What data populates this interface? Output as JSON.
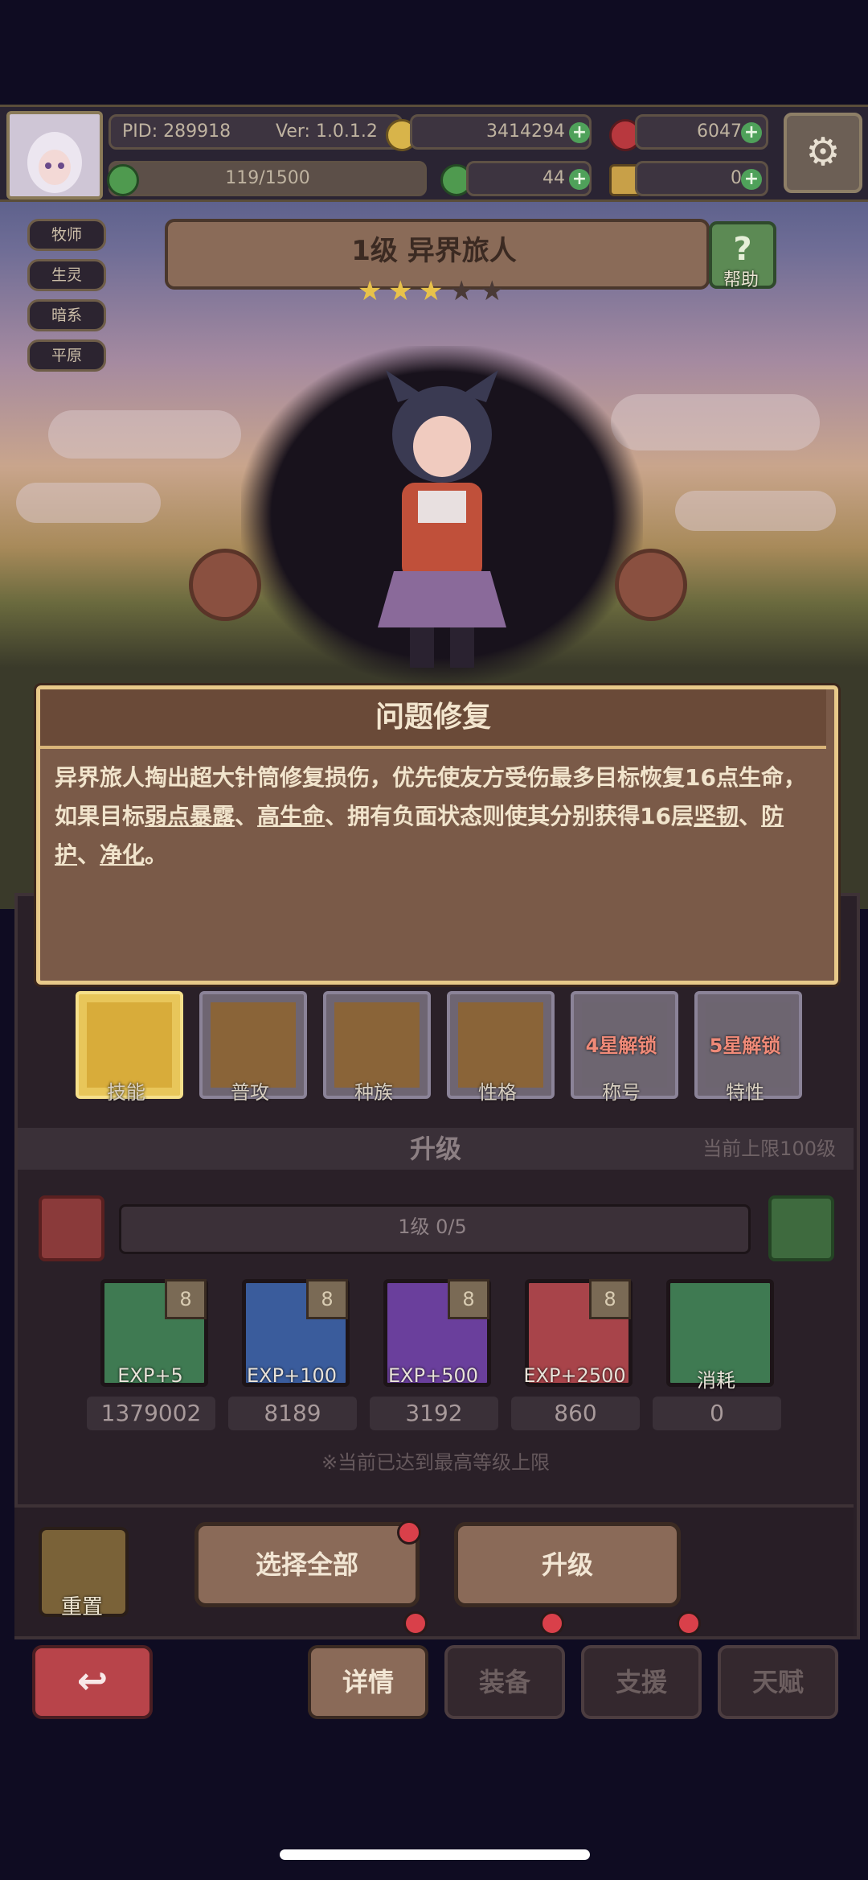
{
  "top": {
    "pid": "PID: 289918",
    "version": "Ver: 1.0.1.2",
    "gold": "3414294",
    "gems": "6047",
    "stamina": "119/1500",
    "clover": "44",
    "keys": "0"
  },
  "tags": [
    "牧师",
    "生灵",
    "暗系",
    "平原"
  ],
  "hero": {
    "name": "1级  异界旅人",
    "stars_total": 5,
    "stars_filled": 3,
    "help_label": "帮助"
  },
  "popup": {
    "title": "问题修复",
    "text_parts": [
      {
        "t": "异界旅人掏出超大针筒修复损伤，优先使友方受伤最多目标恢复16点生命，如果目标",
        "u": false
      },
      {
        "t": "弱点暴露",
        "u": true
      },
      {
        "t": "、",
        "u": false
      },
      {
        "t": "高生命",
        "u": true
      },
      {
        "t": "、拥有负面状态则使其分别获得16层",
        "u": false
      },
      {
        "t": "坚韧",
        "u": true
      },
      {
        "t": "、",
        "u": false
      },
      {
        "t": "防护",
        "u": true
      },
      {
        "t": "、",
        "u": false
      },
      {
        "t": "净化",
        "u": true
      },
      {
        "t": "。",
        "u": false
      }
    ]
  },
  "tabs": [
    {
      "label": "技能",
      "active": true,
      "lock": ""
    },
    {
      "label": "普攻",
      "active": false,
      "lock": ""
    },
    {
      "label": "种族",
      "active": false,
      "lock": ""
    },
    {
      "label": "性格",
      "active": false,
      "lock": ""
    },
    {
      "label": "称号",
      "active": false,
      "lock": "4星解锁"
    },
    {
      "label": "特性",
      "active": false,
      "lock": "5星解锁"
    }
  ],
  "upgrade": {
    "title": "升级",
    "limit": "当前上限100级",
    "level_text": "1级  0/5",
    "items": [
      {
        "label": "EXP+5",
        "count": "1379002",
        "badge": "8",
        "color": "#3f7a52"
      },
      {
        "label": "EXP+100",
        "count": "8189",
        "badge": "8",
        "color": "#3a5c9c"
      },
      {
        "label": "EXP+500",
        "count": "3192",
        "badge": "8",
        "color": "#6a3f9c"
      },
      {
        "label": "EXP+2500",
        "count": "860",
        "badge": "8",
        "color": "#a8444a"
      },
      {
        "label": "消耗",
        "count": "0",
        "badge": "",
        "color": "#3f7a52"
      }
    ],
    "max_note": "※当前已达到最高等级上限"
  },
  "actions": {
    "reset": "重置",
    "select_all": "选择全部",
    "upgrade": "升级"
  },
  "nav": {
    "details": "详情",
    "equip": "装备",
    "support": "支援",
    "talent": "天赋"
  },
  "colors": {
    "accent_gold": "#e8c98a",
    "popup_bg": "#7a5a48",
    "red_dot": "#d9404a",
    "green_plus": "#4fa15a"
  }
}
